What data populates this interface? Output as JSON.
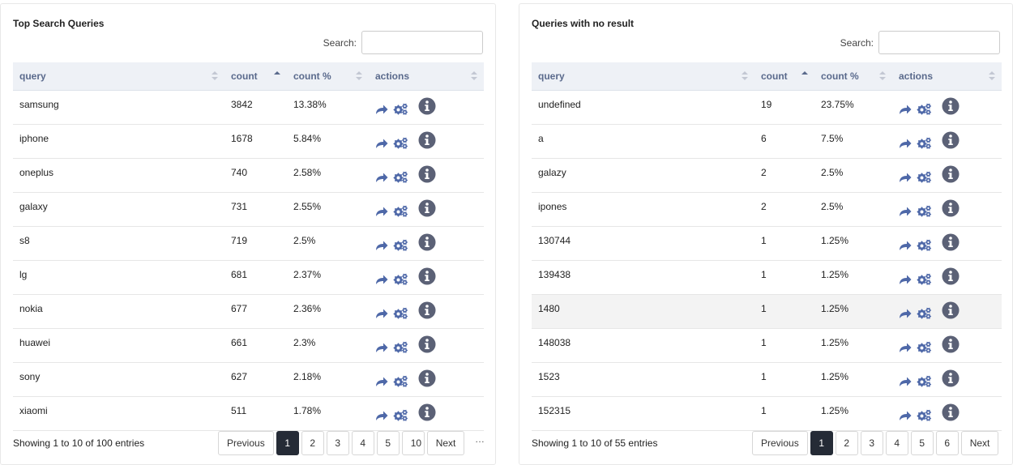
{
  "left": {
    "title": "Top Search Queries",
    "search_label": "Search:",
    "search_value": "",
    "columns": [
      "query",
      "count",
      "count %",
      "actions"
    ],
    "rows": [
      [
        "samsung",
        "3842",
        "13.38%"
      ],
      [
        "iphone",
        "1678",
        "5.84%"
      ],
      [
        "oneplus",
        "740",
        "2.58%"
      ],
      [
        "galaxy",
        "731",
        "2.55%"
      ],
      [
        "s8",
        "719",
        "2.5%"
      ],
      [
        "lg",
        "681",
        "2.37%"
      ],
      [
        "nokia",
        "677",
        "2.36%"
      ],
      [
        "huawei",
        "661",
        "2.3%"
      ],
      [
        "sony",
        "627",
        "2.18%"
      ],
      [
        "xiaomi",
        "511",
        "1.78%"
      ]
    ],
    "info": "Showing 1 to 10 of 100 entries",
    "pager": {
      "prev": "Previous",
      "pages": [
        "1",
        "2",
        "3",
        "4",
        "5",
        "10"
      ],
      "current": "1",
      "next": "Next"
    },
    "ellipsis": "…"
  },
  "right": {
    "title": "Queries with no result",
    "search_label": "Search:",
    "search_value": "",
    "columns": [
      "query",
      "count",
      "count %",
      "actions"
    ],
    "rows": [
      [
        "undefined",
        "19",
        "23.75%"
      ],
      [
        "a",
        "6",
        "7.5%"
      ],
      [
        "galazy",
        "2",
        "2.5%"
      ],
      [
        "ipones",
        "2",
        "2.5%"
      ],
      [
        "130744",
        "1",
        "1.25%"
      ],
      [
        "139438",
        "1",
        "1.25%"
      ],
      [
        "1480",
        "1",
        "1.25%"
      ],
      [
        "148038",
        "1",
        "1.25%"
      ],
      [
        "1523",
        "1",
        "1.25%"
      ],
      [
        "152315",
        "1",
        "1.25%"
      ]
    ],
    "highlighted_row": 6,
    "info": "Showing 1 to 10 of 55 entries",
    "pager": {
      "prev": "Previous",
      "pages": [
        "1",
        "2",
        "3",
        "4",
        "5",
        "6"
      ],
      "current": "1",
      "next": "Next"
    }
  },
  "icons": {
    "share": "share-arrow-icon",
    "gears": "gears-icon",
    "info": "info-circle-icon"
  },
  "colors": {
    "icon": "#4e68a8",
    "info_icon": "#5b6176",
    "header_bg": "#eef1f6",
    "header_text": "#5a6a8c",
    "current_page": "#252b36"
  }
}
